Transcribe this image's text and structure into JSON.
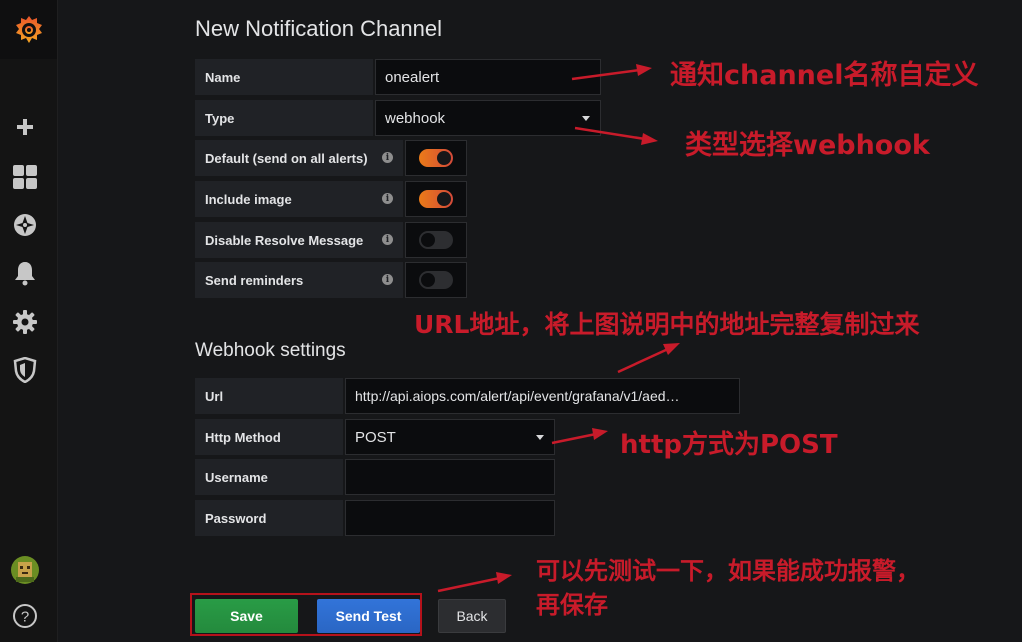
{
  "page": {
    "title": "New Notification Channel",
    "webhook_section_title": "Webhook settings"
  },
  "sidebar": {
    "items": [
      {
        "icon": "grafana-logo-icon"
      },
      {
        "icon": "plus-icon"
      },
      {
        "icon": "dashboards-icon"
      },
      {
        "icon": "explore-compass-icon"
      },
      {
        "icon": "alerting-bell-icon"
      },
      {
        "icon": "configuration-gear-icon"
      },
      {
        "icon": "server-admin-shield-icon"
      },
      {
        "icon": "user-avatar"
      },
      {
        "icon": "help-icon",
        "label": "?"
      }
    ]
  },
  "form": {
    "name": {
      "label": "Name",
      "value": "onealert"
    },
    "type": {
      "label": "Type",
      "value": "webhook"
    },
    "default": {
      "label": "Default (send on all alerts)",
      "on": true
    },
    "include_image": {
      "label": "Include image",
      "on": true
    },
    "disable_resolve": {
      "label": "Disable Resolve Message",
      "on": false
    },
    "send_reminders": {
      "label": "Send reminders",
      "on": false
    },
    "info_glyph": "i"
  },
  "webhook": {
    "url": {
      "label": "Url",
      "value": "http://api.aiops.com/alert/api/event/grafana/v1/aed…"
    },
    "method": {
      "label": "Http Method",
      "value": "POST"
    },
    "username": {
      "label": "Username",
      "value": ""
    },
    "password": {
      "label": "Password",
      "value": ""
    }
  },
  "buttons": {
    "save": "Save",
    "send_test": "Send Test",
    "back": "Back"
  },
  "annotations": {
    "name_note": "通知channel名称自定义",
    "type_note": "类型选择webhook",
    "url_note": "URL地址，将上图说明中的地址完整复制过来",
    "method_note": "http方式为POST",
    "test_note_line1": "可以先测试一下，如果能成功报警，",
    "test_note_line2": "再保存",
    "color": "#c81b2a"
  },
  "colors": {
    "accent_orange": "#eb7b18",
    "save_green": "#299c46",
    "test_blue": "#3274d9"
  }
}
